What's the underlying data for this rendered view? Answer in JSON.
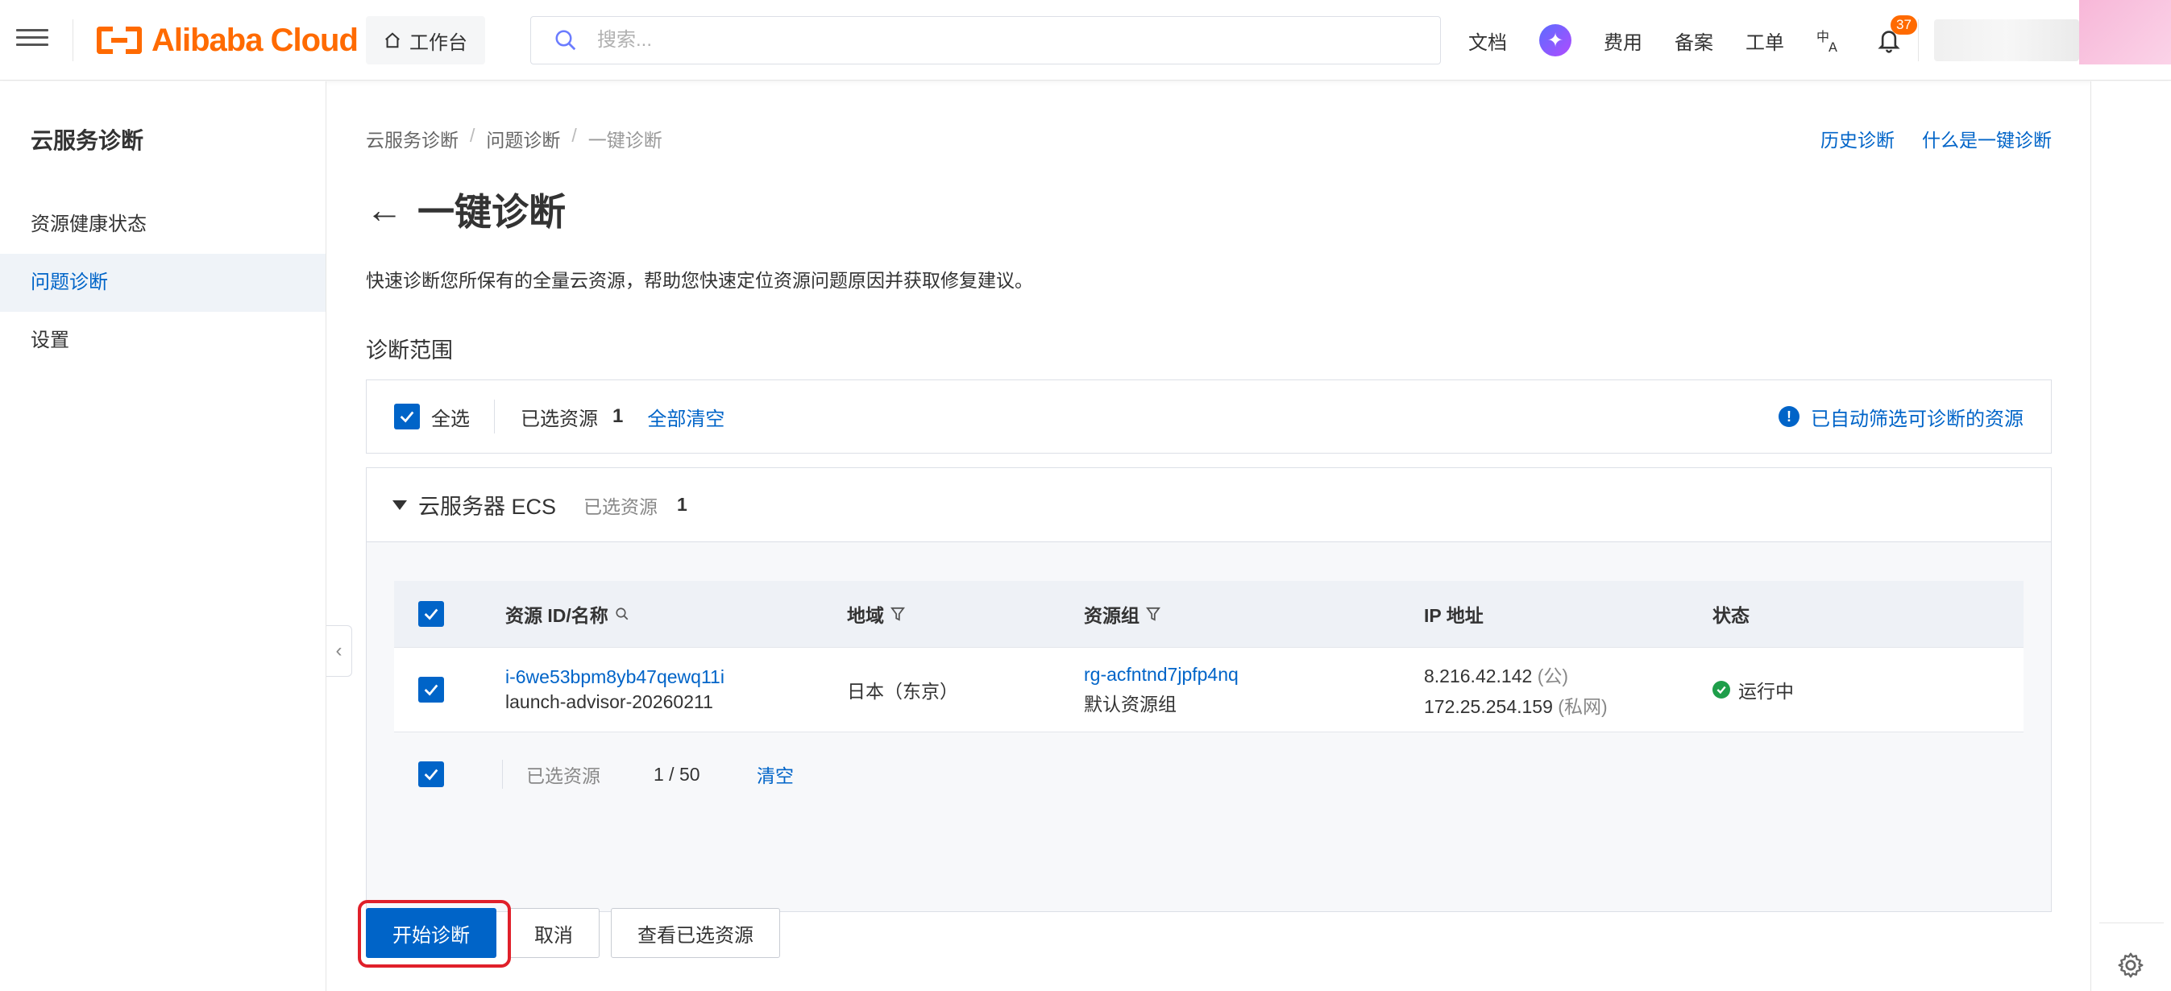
{
  "topbar": {
    "logo_text": "Alibaba Cloud",
    "workbench_label": "工作台",
    "search_placeholder": "搜索...",
    "nav": {
      "docs": "文档",
      "billing": "费用",
      "icp": "备案",
      "ticket": "工单"
    },
    "notification_count": "37",
    "brand_color": "#ff6a00"
  },
  "sidebar": {
    "title": "云服务诊断",
    "items": [
      {
        "label": "资源健康状态",
        "active": false
      },
      {
        "label": "问题诊断",
        "active": true
      },
      {
        "label": "设置",
        "active": false
      }
    ]
  },
  "main": {
    "breadcrumb": [
      "云服务诊断",
      "问题诊断",
      "一键诊断"
    ],
    "top_links": {
      "history": "历史诊断",
      "what_is": "什么是一键诊断"
    },
    "title": "一键诊断",
    "description": "快速诊断您所保有的全量云资源，帮助您快速定位资源问题原因并获取修复建议。",
    "scope_title": "诊断范围",
    "selection_bar": {
      "select_all": "全选",
      "selected_label": "已选资源",
      "selected_count": "1",
      "clear_all": "全部清空",
      "auto_filter_note": "已自动筛选可诊断的资源"
    },
    "ecs_group": {
      "title": "云服务器 ECS",
      "selected_label": "已选资源",
      "selected_count": "1",
      "columns": {
        "resource": "资源 ID/名称",
        "region": "地域",
        "group": "资源组",
        "ip": "IP 地址",
        "status": "状态"
      },
      "rows": [
        {
          "id": "i-6we53bpm8yb47qewq11i",
          "name": "launch-advisor-20260211",
          "region": "日本（东京）",
          "group_id": "rg-acfntnd7jpfp4nq",
          "group_name": "默认资源组",
          "ip_public": "8.216.42.142",
          "ip_public_tag": "(公)",
          "ip_private": "172.25.254.159",
          "ip_private_tag": "(私网)",
          "status": "运行中"
        }
      ],
      "footer": {
        "selected_label": "已选资源",
        "selected_count": "1 / 50",
        "clear": "清空"
      }
    },
    "buttons": {
      "start": "开始诊断",
      "cancel": "取消",
      "view_selected": "查看已选资源"
    }
  },
  "colors": {
    "accent": "#0064c8",
    "success": "#1e9e4a",
    "highlight": "#e0202a"
  }
}
